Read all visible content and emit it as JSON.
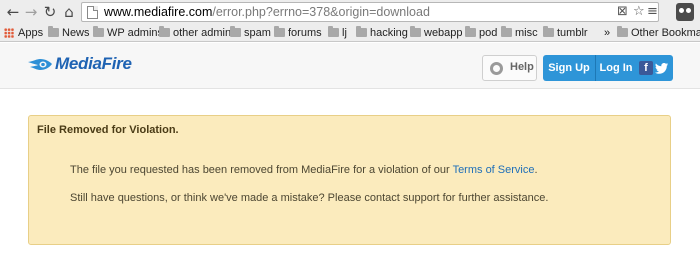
{
  "browser": {
    "url_host": "www.mediafire.com",
    "url_rest": "/error.php?errno=378&origin=download",
    "nav": {
      "back": "←",
      "forward": "→",
      "reload": "↻",
      "home": "⌂"
    },
    "omnibox_icons": [
      "page-icon",
      "clear-icon",
      "star-icon",
      "menu-icon"
    ],
    "extension_icon": "owl-icon"
  },
  "bookmarks": {
    "apps_label": "Apps",
    "items": [
      {
        "label": "News"
      },
      {
        "label": "WP admins"
      },
      {
        "label": "other admin"
      },
      {
        "label": "spam"
      },
      {
        "label": "forums"
      },
      {
        "label": "lj"
      },
      {
        "label": "hacking"
      },
      {
        "label": "webapp"
      },
      {
        "label": "pod"
      },
      {
        "label": "misc"
      },
      {
        "label": "tumblr"
      }
    ],
    "overflow": "»",
    "other": "Other Bookmarks"
  },
  "header": {
    "logo_text": "MediaFire",
    "help_label": "Help",
    "signup_label": "Sign Up",
    "login_label": "Log In",
    "facebook": "f",
    "brand_color": "#2e95d8"
  },
  "notice": {
    "title": "File Removed for Violation.",
    "line1_prefix": "The file you requested has been removed from MediaFire for a violation of our ",
    "line1_link": "Terms of Service",
    "line1_suffix": ".",
    "line2": "Still have questions, or think we've made a mistake? Please contact support for further assistance."
  }
}
